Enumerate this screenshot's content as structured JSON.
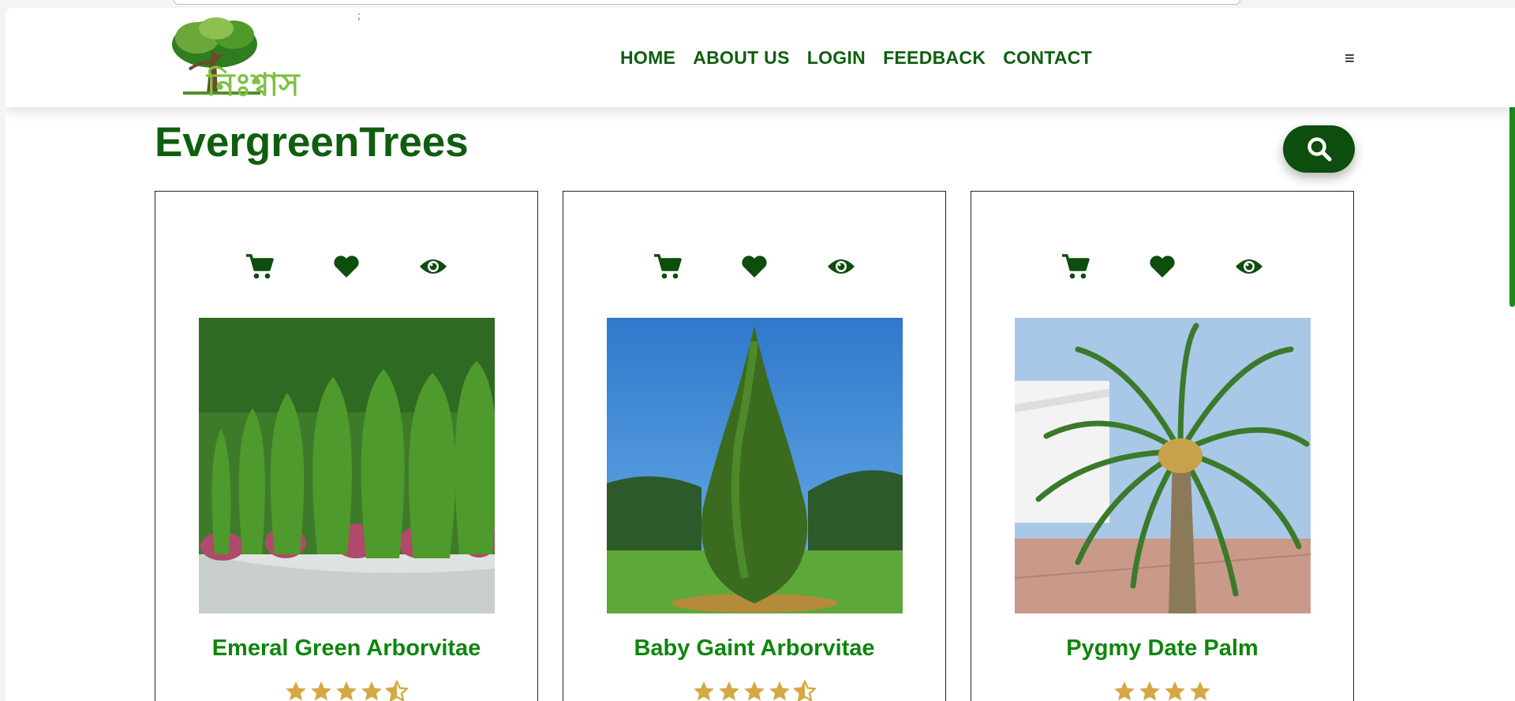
{
  "nav": {
    "items": [
      "HOME",
      "ABOUT US",
      "LOGIN",
      "FEEDBACK",
      "CONTACT"
    ],
    "menu_icon": "≡",
    "semicolon": ";"
  },
  "logo": {
    "text": "নিঃশ্বাস",
    "icon": "tree-logo"
  },
  "page": {
    "title": "EvergreenTrees"
  },
  "search": {
    "icon": "search-icon"
  },
  "colors": {
    "brand_green": "#0f5e0f",
    "dark_green": "#0d4d0d",
    "name_green": "#0d860d",
    "star_gold": "#d4a843"
  },
  "products": [
    {
      "name": "Emeral Green Arborvitae",
      "rating": 4.5,
      "actions": [
        "cart-icon",
        "heart-icon",
        "eye-icon"
      ]
    },
    {
      "name": "Baby Gaint Arborvitae",
      "rating": 4.5,
      "actions": [
        "cart-icon",
        "heart-icon",
        "eye-icon"
      ]
    },
    {
      "name": "Pygmy Date Palm",
      "rating": 4,
      "actions": [
        "cart-icon",
        "heart-icon",
        "eye-icon"
      ]
    }
  ]
}
